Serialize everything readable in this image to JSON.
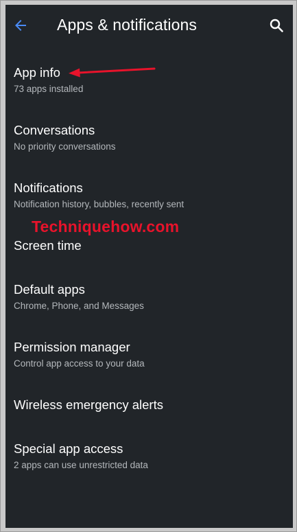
{
  "header": {
    "title": "Apps & notifications",
    "back_icon": "arrow-back-icon",
    "search_icon": "search-icon",
    "accent_color": "#4a8bf5"
  },
  "items": [
    {
      "title": "App info",
      "subtitle": "73 apps installed"
    },
    {
      "title": "Conversations",
      "subtitle": "No priority conversations"
    },
    {
      "title": "Notifications",
      "subtitle": "Notification history, bubbles, recently sent"
    },
    {
      "title": "Screen time",
      "subtitle": ""
    },
    {
      "title": "Default apps",
      "subtitle": "Chrome, Phone, and Messages"
    },
    {
      "title": "Permission manager",
      "subtitle": "Control app access to your data"
    },
    {
      "title": "Wireless emergency alerts",
      "subtitle": ""
    },
    {
      "title": "Special app access",
      "subtitle": "2 apps can use unrestricted data"
    }
  ],
  "annotation": {
    "watermark": "Techniquehow.com",
    "arrow_color": "#e8132b"
  }
}
